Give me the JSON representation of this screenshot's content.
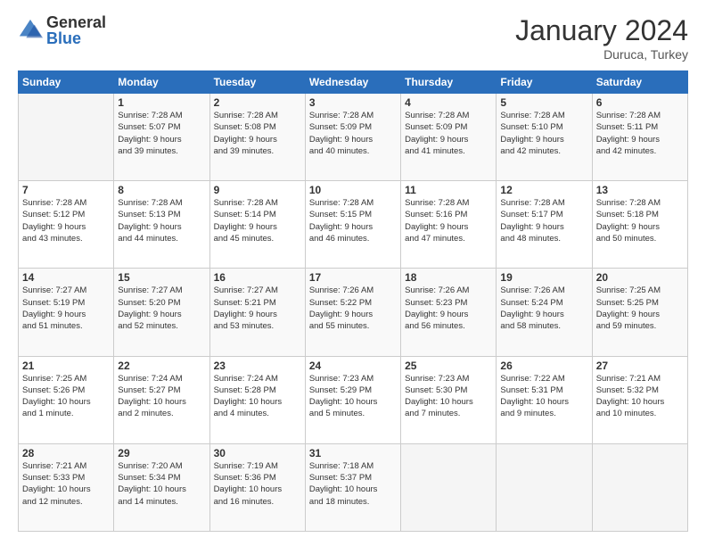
{
  "logo": {
    "general": "General",
    "blue": "Blue"
  },
  "title": "January 2024",
  "location": "Duruca, Turkey",
  "days_of_week": [
    "Sunday",
    "Monday",
    "Tuesday",
    "Wednesday",
    "Thursday",
    "Friday",
    "Saturday"
  ],
  "weeks": [
    [
      {
        "day": "",
        "info": ""
      },
      {
        "day": "1",
        "info": "Sunrise: 7:28 AM\nSunset: 5:07 PM\nDaylight: 9 hours\nand 39 minutes."
      },
      {
        "day": "2",
        "info": "Sunrise: 7:28 AM\nSunset: 5:08 PM\nDaylight: 9 hours\nand 39 minutes."
      },
      {
        "day": "3",
        "info": "Sunrise: 7:28 AM\nSunset: 5:09 PM\nDaylight: 9 hours\nand 40 minutes."
      },
      {
        "day": "4",
        "info": "Sunrise: 7:28 AM\nSunset: 5:09 PM\nDaylight: 9 hours\nand 41 minutes."
      },
      {
        "day": "5",
        "info": "Sunrise: 7:28 AM\nSunset: 5:10 PM\nDaylight: 9 hours\nand 42 minutes."
      },
      {
        "day": "6",
        "info": "Sunrise: 7:28 AM\nSunset: 5:11 PM\nDaylight: 9 hours\nand 42 minutes."
      }
    ],
    [
      {
        "day": "7",
        "info": "Sunrise: 7:28 AM\nSunset: 5:12 PM\nDaylight: 9 hours\nand 43 minutes."
      },
      {
        "day": "8",
        "info": "Sunrise: 7:28 AM\nSunset: 5:13 PM\nDaylight: 9 hours\nand 44 minutes."
      },
      {
        "day": "9",
        "info": "Sunrise: 7:28 AM\nSunset: 5:14 PM\nDaylight: 9 hours\nand 45 minutes."
      },
      {
        "day": "10",
        "info": "Sunrise: 7:28 AM\nSunset: 5:15 PM\nDaylight: 9 hours\nand 46 minutes."
      },
      {
        "day": "11",
        "info": "Sunrise: 7:28 AM\nSunset: 5:16 PM\nDaylight: 9 hours\nand 47 minutes."
      },
      {
        "day": "12",
        "info": "Sunrise: 7:28 AM\nSunset: 5:17 PM\nDaylight: 9 hours\nand 48 minutes."
      },
      {
        "day": "13",
        "info": "Sunrise: 7:28 AM\nSunset: 5:18 PM\nDaylight: 9 hours\nand 50 minutes."
      }
    ],
    [
      {
        "day": "14",
        "info": "Sunrise: 7:27 AM\nSunset: 5:19 PM\nDaylight: 9 hours\nand 51 minutes."
      },
      {
        "day": "15",
        "info": "Sunrise: 7:27 AM\nSunset: 5:20 PM\nDaylight: 9 hours\nand 52 minutes."
      },
      {
        "day": "16",
        "info": "Sunrise: 7:27 AM\nSunset: 5:21 PM\nDaylight: 9 hours\nand 53 minutes."
      },
      {
        "day": "17",
        "info": "Sunrise: 7:26 AM\nSunset: 5:22 PM\nDaylight: 9 hours\nand 55 minutes."
      },
      {
        "day": "18",
        "info": "Sunrise: 7:26 AM\nSunset: 5:23 PM\nDaylight: 9 hours\nand 56 minutes."
      },
      {
        "day": "19",
        "info": "Sunrise: 7:26 AM\nSunset: 5:24 PM\nDaylight: 9 hours\nand 58 minutes."
      },
      {
        "day": "20",
        "info": "Sunrise: 7:25 AM\nSunset: 5:25 PM\nDaylight: 9 hours\nand 59 minutes."
      }
    ],
    [
      {
        "day": "21",
        "info": "Sunrise: 7:25 AM\nSunset: 5:26 PM\nDaylight: 10 hours\nand 1 minute."
      },
      {
        "day": "22",
        "info": "Sunrise: 7:24 AM\nSunset: 5:27 PM\nDaylight: 10 hours\nand 2 minutes."
      },
      {
        "day": "23",
        "info": "Sunrise: 7:24 AM\nSunset: 5:28 PM\nDaylight: 10 hours\nand 4 minutes."
      },
      {
        "day": "24",
        "info": "Sunrise: 7:23 AM\nSunset: 5:29 PM\nDaylight: 10 hours\nand 5 minutes."
      },
      {
        "day": "25",
        "info": "Sunrise: 7:23 AM\nSunset: 5:30 PM\nDaylight: 10 hours\nand 7 minutes."
      },
      {
        "day": "26",
        "info": "Sunrise: 7:22 AM\nSunset: 5:31 PM\nDaylight: 10 hours\nand 9 minutes."
      },
      {
        "day": "27",
        "info": "Sunrise: 7:21 AM\nSunset: 5:32 PM\nDaylight: 10 hours\nand 10 minutes."
      }
    ],
    [
      {
        "day": "28",
        "info": "Sunrise: 7:21 AM\nSunset: 5:33 PM\nDaylight: 10 hours\nand 12 minutes."
      },
      {
        "day": "29",
        "info": "Sunrise: 7:20 AM\nSunset: 5:34 PM\nDaylight: 10 hours\nand 14 minutes."
      },
      {
        "day": "30",
        "info": "Sunrise: 7:19 AM\nSunset: 5:36 PM\nDaylight: 10 hours\nand 16 minutes."
      },
      {
        "day": "31",
        "info": "Sunrise: 7:18 AM\nSunset: 5:37 PM\nDaylight: 10 hours\nand 18 minutes."
      },
      {
        "day": "",
        "info": ""
      },
      {
        "day": "",
        "info": ""
      },
      {
        "day": "",
        "info": ""
      }
    ]
  ]
}
